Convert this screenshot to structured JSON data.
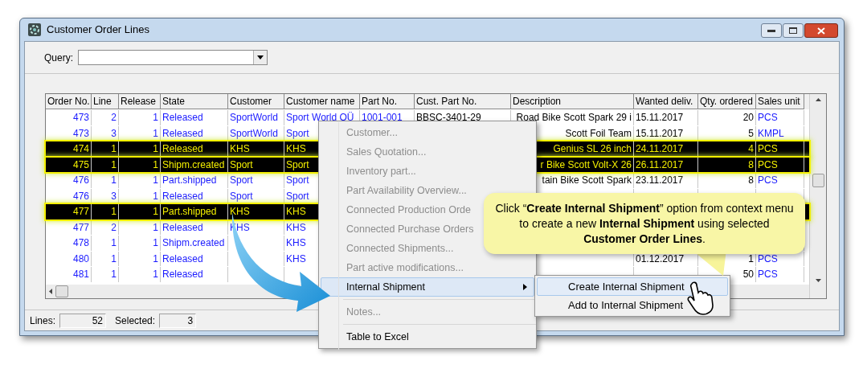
{
  "window": {
    "title": "Customer Order Lines"
  },
  "query": {
    "label": "Query:"
  },
  "table": {
    "columns": [
      {
        "label": "Order No.",
        "kind": "ref_number"
      },
      {
        "label": "Line",
        "kind": "ref_number"
      },
      {
        "label": "Release",
        "kind": "ref_number"
      },
      {
        "label": "State",
        "kind": "ref_text"
      },
      {
        "label": "Customer",
        "kind": "ref_text"
      },
      {
        "label": "Customer name",
        "kind": "ref_text"
      },
      {
        "label": "Part No.",
        "kind": "ref_text"
      },
      {
        "label": "Cust. Part No.",
        "kind": "text"
      },
      {
        "label": "Description",
        "kind": "tail_text"
      },
      {
        "label": "Wanted deliv.",
        "kind": "text"
      },
      {
        "label": "Qty. ordered",
        "kind": "number"
      },
      {
        "label": "Sales unit",
        "kind": "ref_text"
      }
    ],
    "rows": [
      {
        "selected": false,
        "cells": [
          "473",
          "2",
          "1",
          "Released",
          "SportWorld",
          "Sport World OÜ",
          "1001-001",
          "BBSC-3401-29",
          "Road Bike Scott Spark 29 i",
          "15.11.2017",
          "20",
          "PCS"
        ]
      },
      {
        "selected": false,
        "cells": [
          "473",
          "3",
          "1",
          "Released",
          "SportWorld",
          "Sport",
          null,
          null,
          "Scott Foil Team",
          "15.11.2017",
          "5",
          "KMPL"
        ]
      },
      {
        "selected": true,
        "cells": [
          "474",
          "1",
          "1",
          "Released",
          "KHS",
          "KHS",
          null,
          null,
          "Genius SL 26 inch",
          "24.11.2017",
          "4",
          "PCS"
        ]
      },
      {
        "selected": true,
        "cells": [
          "475",
          "1",
          "1",
          "Shipm.created",
          "Sport",
          "Sport",
          null,
          null,
          "r Bike Scott Volt-X 26",
          "26.11.2017",
          "8",
          "PCS"
        ]
      },
      {
        "selected": false,
        "cells": [
          "476",
          "1",
          "1",
          "Part.shipped",
          "Sport",
          "Sport",
          null,
          null,
          "tain Bike Scott Spark",
          "23.11.2017",
          "8",
          "PCS"
        ]
      },
      {
        "selected": false,
        "cells": [
          "476",
          "3",
          "1",
          "Released",
          "Sport",
          "Sport",
          null,
          null,
          null,
          null,
          null,
          null
        ]
      },
      {
        "selected": true,
        "cells": [
          "477",
          "1",
          "1",
          "Part.shipped",
          "KHS",
          "KHS",
          null,
          null,
          null,
          null,
          null,
          null
        ]
      },
      {
        "selected": false,
        "cells": [
          "477",
          "2",
          "1",
          "Released",
          "KHS",
          "KHS",
          null,
          null,
          null,
          null,
          null,
          null
        ]
      },
      {
        "selected": false,
        "cells": [
          "478",
          "1",
          "1",
          "Shipm.created",
          null,
          "KHS",
          null,
          null,
          null,
          null,
          null,
          null
        ]
      },
      {
        "selected": false,
        "cells": [
          "480",
          "1",
          "1",
          "Released",
          null,
          "KHS",
          null,
          null,
          null,
          "01.12.2017",
          "1",
          "PCS"
        ]
      },
      {
        "selected": false,
        "cells": [
          "481",
          "1",
          "1",
          "Released",
          null,
          null,
          null,
          null,
          null,
          null,
          "50",
          "PCS"
        ]
      }
    ]
  },
  "status_bar": {
    "lines_label": "Lines:",
    "lines": "52",
    "selected_label": "Selected:",
    "selected": "3"
  },
  "context_menu": {
    "items": [
      {
        "label": "Customer...",
        "disabled": true,
        "highlighted": false,
        "has_submenu": false,
        "separator_before": false
      },
      {
        "label": "Sales Quotation...",
        "disabled": true,
        "highlighted": false,
        "has_submenu": false,
        "separator_before": false
      },
      {
        "label": "Inventory part...",
        "disabled": true,
        "highlighted": false,
        "has_submenu": false,
        "separator_before": false
      },
      {
        "label": "Part Availability Overview...",
        "disabled": true,
        "highlighted": false,
        "has_submenu": false,
        "separator_before": false
      },
      {
        "label": "Connected Production Orde",
        "disabled": true,
        "highlighted": false,
        "has_submenu": false,
        "separator_before": false
      },
      {
        "label": "Connected Purchase Orders",
        "disabled": true,
        "highlighted": false,
        "has_submenu": false,
        "separator_before": false
      },
      {
        "label": "Connected Shipments...",
        "disabled": true,
        "highlighted": false,
        "has_submenu": false,
        "separator_before": false
      },
      {
        "label": "Part active modifications...",
        "disabled": true,
        "highlighted": false,
        "has_submenu": false,
        "separator_before": false
      },
      {
        "label": "Internal Shipment",
        "disabled": false,
        "highlighted": true,
        "has_submenu": true,
        "separator_before": false
      },
      {
        "label": "Notes...",
        "disabled": true,
        "highlighted": false,
        "has_submenu": false,
        "separator_before": true
      },
      {
        "label": "Table to Excel",
        "disabled": false,
        "highlighted": false,
        "has_submenu": false,
        "separator_before": true
      }
    ]
  },
  "submenu": {
    "items": [
      {
        "label": "Create Internal Shipment",
        "highlighted": true
      },
      {
        "label": "Add to Internal Shipment",
        "highlighted": false
      }
    ]
  },
  "callout": {
    "text": "Click “**Create Internal Shipment**” option from context menu to create a new **Internal Shipment** using selected **Customer Order Lines**."
  }
}
